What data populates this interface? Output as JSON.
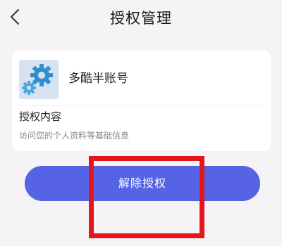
{
  "header": {
    "title": "授权管理",
    "back_icon": "chevron-left-icon"
  },
  "card": {
    "app_icon": "gear-settings-icon",
    "app_name": "多酷半账号",
    "section_title": "授权内容",
    "section_desc": "访问您的个人资料等基础信息"
  },
  "actions": {
    "revoke_label": "解除授权",
    "button_color": "#5563e4"
  },
  "annotation": {
    "highlight_color": "#e3161c"
  }
}
